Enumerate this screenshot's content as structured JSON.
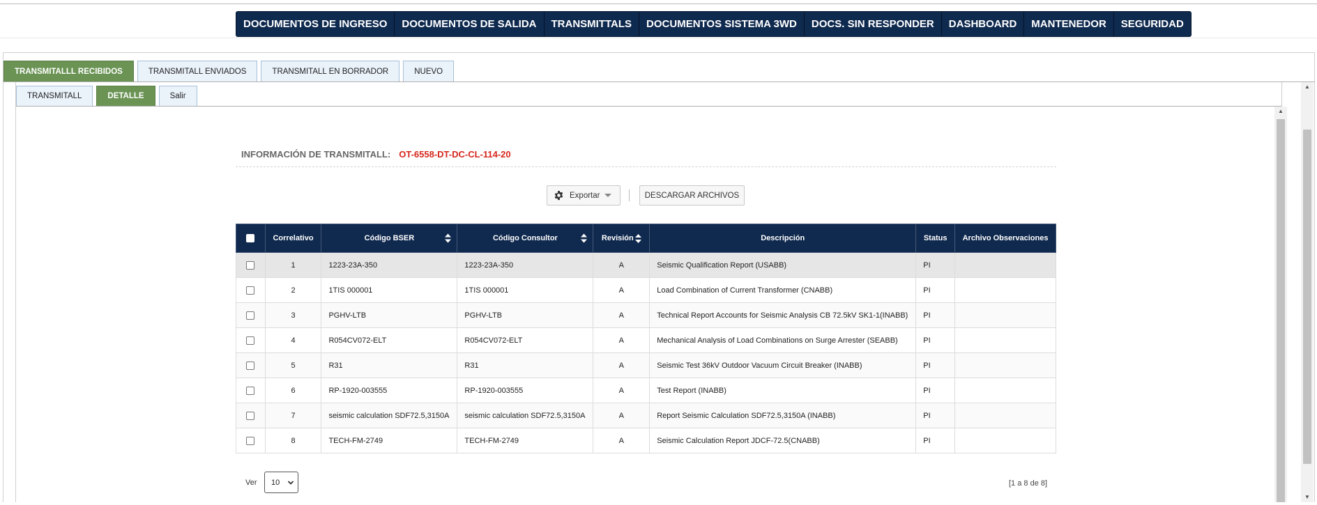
{
  "nav": {
    "items": [
      {
        "label": "DOCUMENTOS DE INGRESO"
      },
      {
        "label": "DOCUMENTOS DE SALIDA"
      },
      {
        "label": "TRANSMITTALS"
      },
      {
        "label": "DOCUMENTOS SISTEMA 3WD"
      },
      {
        "label": "DOCS. SIN RESPONDER"
      },
      {
        "label": "DASHBOARD"
      },
      {
        "label": "MANTENEDOR"
      },
      {
        "label": "SEGURIDAD"
      }
    ]
  },
  "tabs_main": [
    {
      "label": "TRANSMITALLL RECIBIDOS",
      "active": true
    },
    {
      "label": "TRANSMITALL ENVIADOS",
      "active": false
    },
    {
      "label": "TRANSMITALL EN BORRADOR",
      "active": false
    },
    {
      "label": "NUEVO",
      "active": false
    }
  ],
  "tabs_sub": [
    {
      "label": "TRANSMITALL",
      "active": false
    },
    {
      "label": "DETALLE",
      "active": true
    },
    {
      "label": "Salir",
      "active": false
    }
  ],
  "info": {
    "label": "INFORMACIÓN DE TRANSMITALL:",
    "code": "OT-6558-DT-DC-CL-114-20"
  },
  "toolbar": {
    "export_label": "Exportar",
    "download_label": "DESCARGAR ARCHIVOS"
  },
  "table": {
    "headers": {
      "correlativo": "Correlativo",
      "codigo_bser": "Código BSER",
      "codigo_consultor": "Código Consultor",
      "revision": "Revisión",
      "descripcion": "Descripción",
      "status": "Status",
      "archivo": "Archivo Observaciones"
    },
    "rows": [
      {
        "correlativo": "1",
        "codigo_bser": "1223-23A-350",
        "codigo_consultor": "1223-23A-350",
        "revision": "A",
        "descripcion": "Seismic Qualification Report (USABB)",
        "status": "PI",
        "archivo": ""
      },
      {
        "correlativo": "2",
        "codigo_bser": "1TIS 000001",
        "codigo_consultor": "1TIS 000001",
        "revision": "A",
        "descripcion": "Load Combination of Current Transformer (CNABB)",
        "status": "PI",
        "archivo": ""
      },
      {
        "correlativo": "3",
        "codigo_bser": "PGHV-LTB",
        "codigo_consultor": "PGHV-LTB",
        "revision": "A",
        "descripcion": "Technical Report Accounts for Seismic Analysis CB 72.5kV SK1-1(INABB)",
        "status": "PI",
        "archivo": ""
      },
      {
        "correlativo": "4",
        "codigo_bser": "R054CV072-ELT",
        "codigo_consultor": "R054CV072-ELT",
        "revision": "A",
        "descripcion": "Mechanical Analysis of Load Combinations on Surge Arrester (SEABB)",
        "status": "PI",
        "archivo": ""
      },
      {
        "correlativo": "5",
        "codigo_bser": "R31",
        "codigo_consultor": "R31",
        "revision": "A",
        "descripcion": "Seismic Test 36kV Outdoor Vacuum Circuit Breaker (INABB)",
        "status": "PI",
        "archivo": ""
      },
      {
        "correlativo": "6",
        "codigo_bser": "RP-1920-003555",
        "codigo_consultor": "RP-1920-003555",
        "revision": "A",
        "descripcion": "Test Report (INABB)",
        "status": "PI",
        "archivo": ""
      },
      {
        "correlativo": "7",
        "codigo_bser": "seismic calculation SDF72.5,3150A",
        "codigo_consultor": "seismic calculation SDF72.5,3150A",
        "revision": "A",
        "descripcion": "Report Seismic Calculation SDF72.5,3150A (INABB)",
        "status": "PI",
        "archivo": ""
      },
      {
        "correlativo": "8",
        "codigo_bser": "TECH-FM-2749",
        "codigo_consultor": "TECH-FM-2749",
        "revision": "A",
        "descripcion": "Seismic Calculation Report JDCF-72.5(CNABB)",
        "status": "PI",
        "archivo": ""
      }
    ]
  },
  "footer": {
    "ver_label": "Ver",
    "page_size": "10",
    "pager_info": "[1 a 8 de 8]"
  },
  "colors": {
    "nav_bg": "#0f2a4f",
    "active_tab": "#6a9354",
    "inactive_tab": "#eaf2fa",
    "code_red": "#d6261c",
    "table_header": "#102a4f"
  }
}
